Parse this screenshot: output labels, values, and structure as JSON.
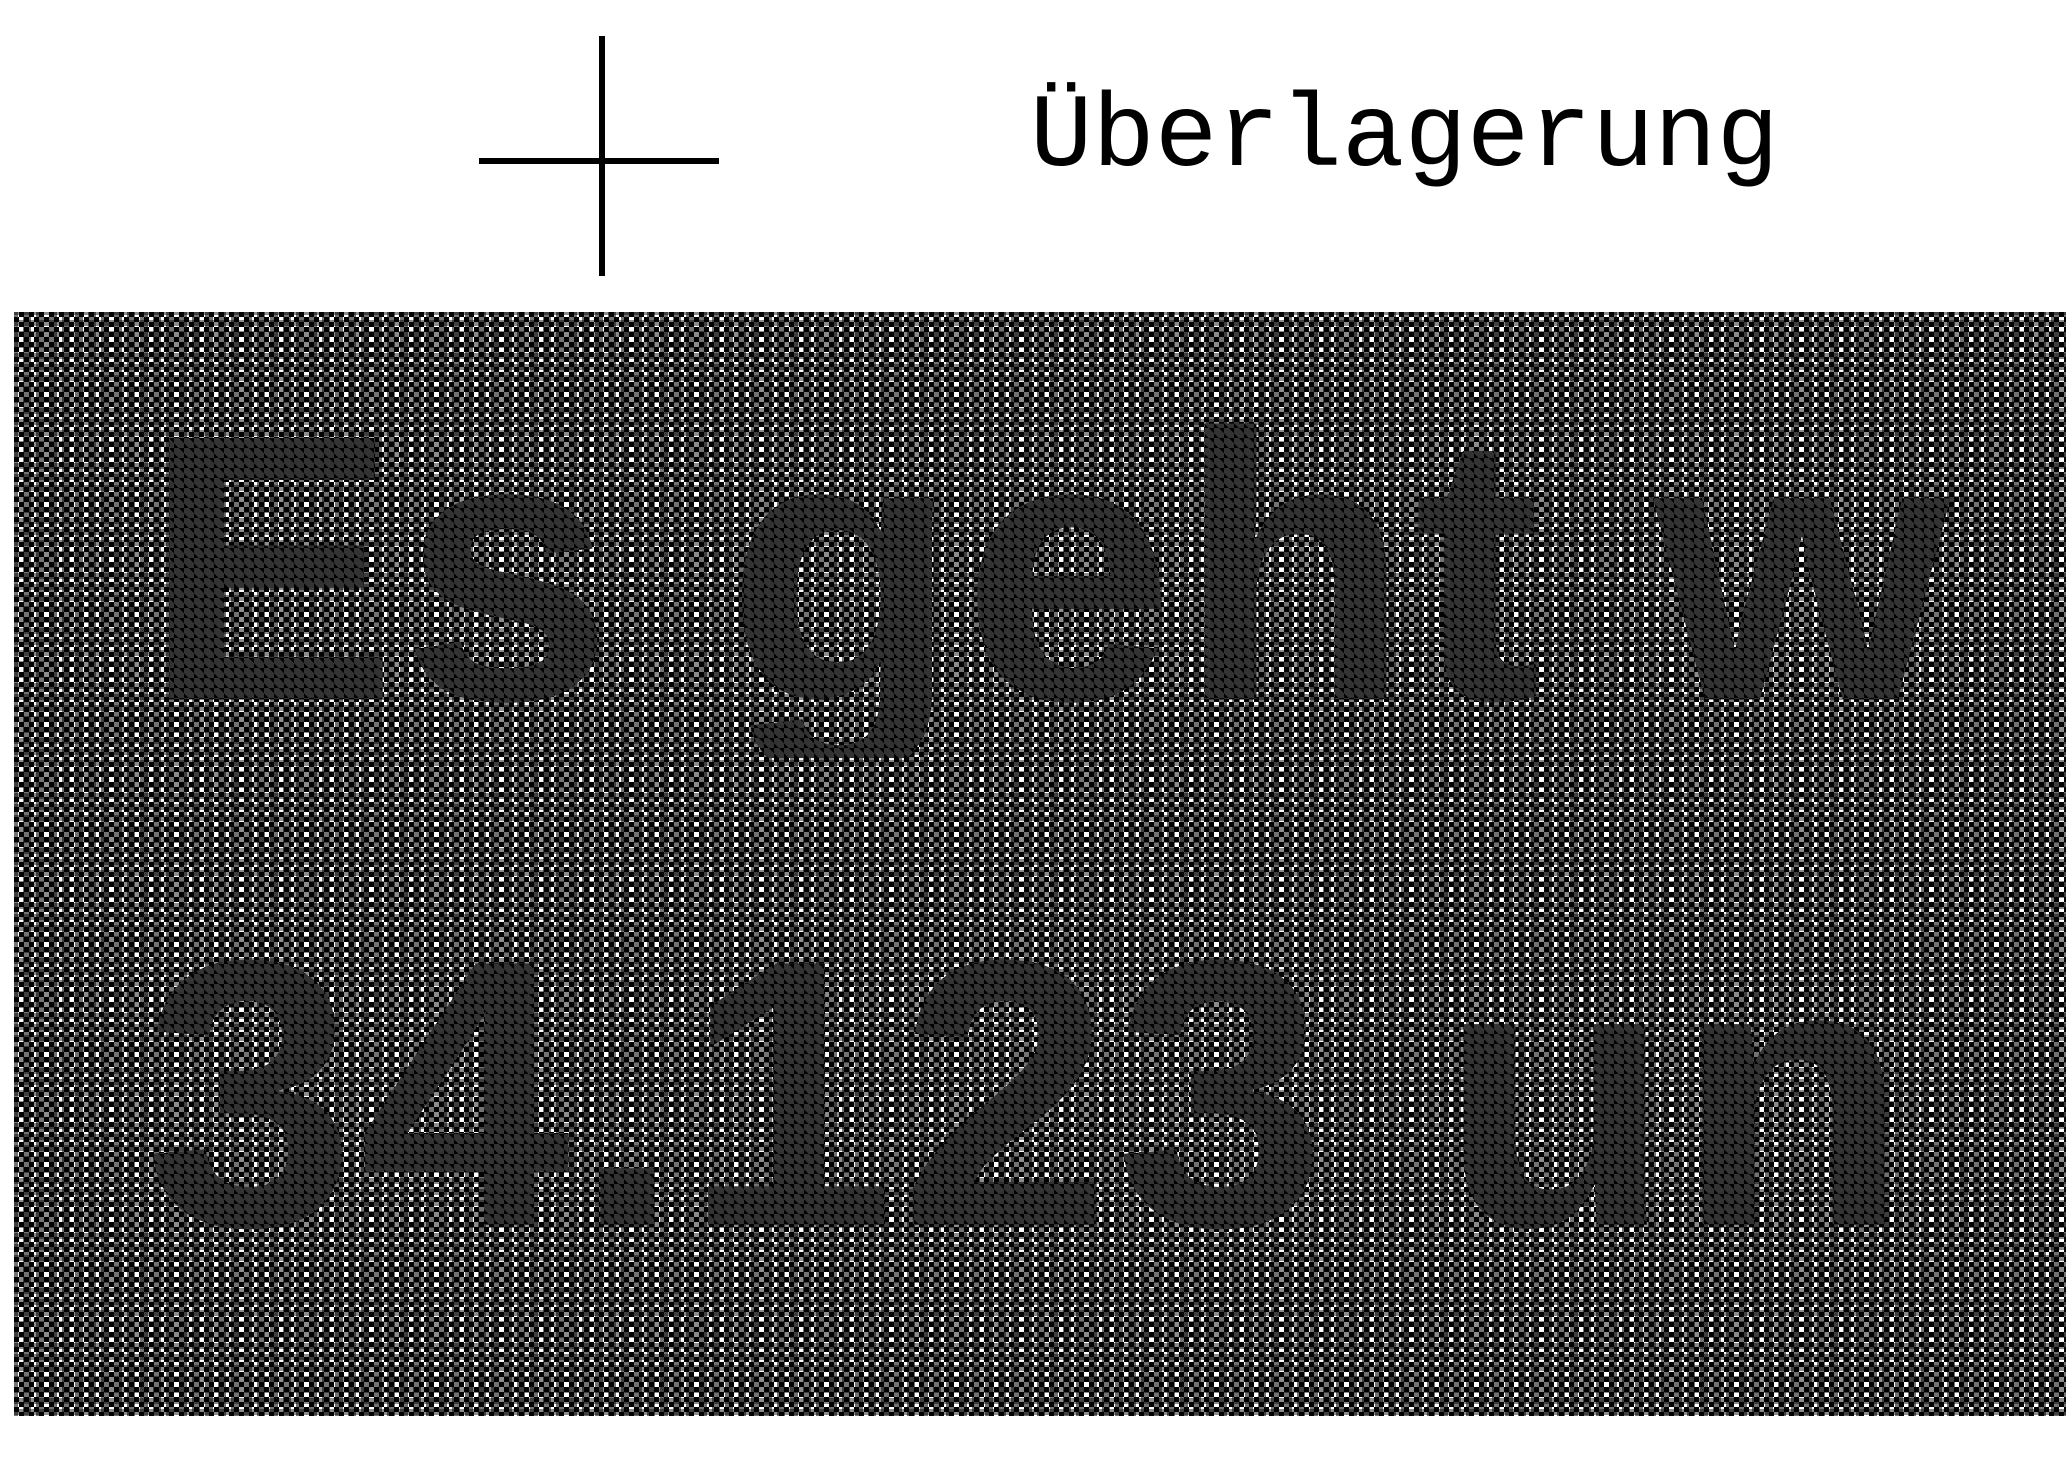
{
  "heading": "Überlagerung",
  "text_lines": [
    "Es geht w",
    "34.123 un"
  ],
  "icons": {
    "crosshair": "crosshair-icon"
  },
  "colors": {
    "foreground": "#000000",
    "background": "#ffffff"
  }
}
